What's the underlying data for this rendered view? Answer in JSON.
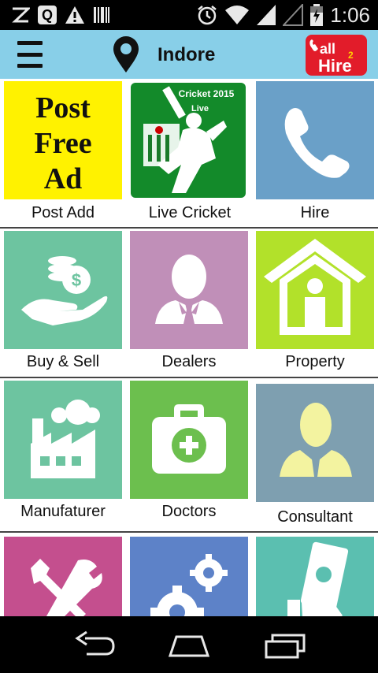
{
  "status_bar": {
    "time": "1:06",
    "notif_letter": "Q"
  },
  "app_bar": {
    "city": "Indore",
    "logo_text_top": "all",
    "logo_text_bottom": "Hire",
    "logo_number": "2"
  },
  "tiles": [
    {
      "label": "Post Add",
      "title_lines": [
        "Post",
        "Free",
        "Ad"
      ],
      "color": "#fff200"
    },
    {
      "label": "Live Cricket",
      "caption_line1": "Cricket 2015",
      "caption_line2": "Live",
      "color": "#1a8a2a"
    },
    {
      "label": "Hire",
      "color": "#6aa0c8"
    },
    {
      "label": "Buy & Sell",
      "color": "#6dc4a0"
    },
    {
      "label": "Dealers",
      "color": "#c08fb8"
    },
    {
      "label": "Property",
      "color": "#b2e12a"
    },
    {
      "label": "Manufaturer",
      "color": "#6dc4a0"
    },
    {
      "label": "Doctors",
      "color": "#6cbf4e"
    },
    {
      "label": "Consultant",
      "color": "#7e9fb0"
    },
    {
      "label": "",
      "color": "#c44f8e"
    },
    {
      "label": "",
      "color": "#5d82c8"
    },
    {
      "label": "",
      "color": "#5bbfb0"
    }
  ],
  "icons": [
    "menu-icon",
    "location-pin-icon",
    "phone-icon",
    "money-hand-icon",
    "dealer-person-icon",
    "house-icon",
    "factory-icon",
    "medical-kit-icon",
    "consultant-person-icon",
    "tools-icon",
    "gears-icon",
    "cash-hand-icon",
    "back-icon",
    "home-icon",
    "recent-apps-icon"
  ]
}
